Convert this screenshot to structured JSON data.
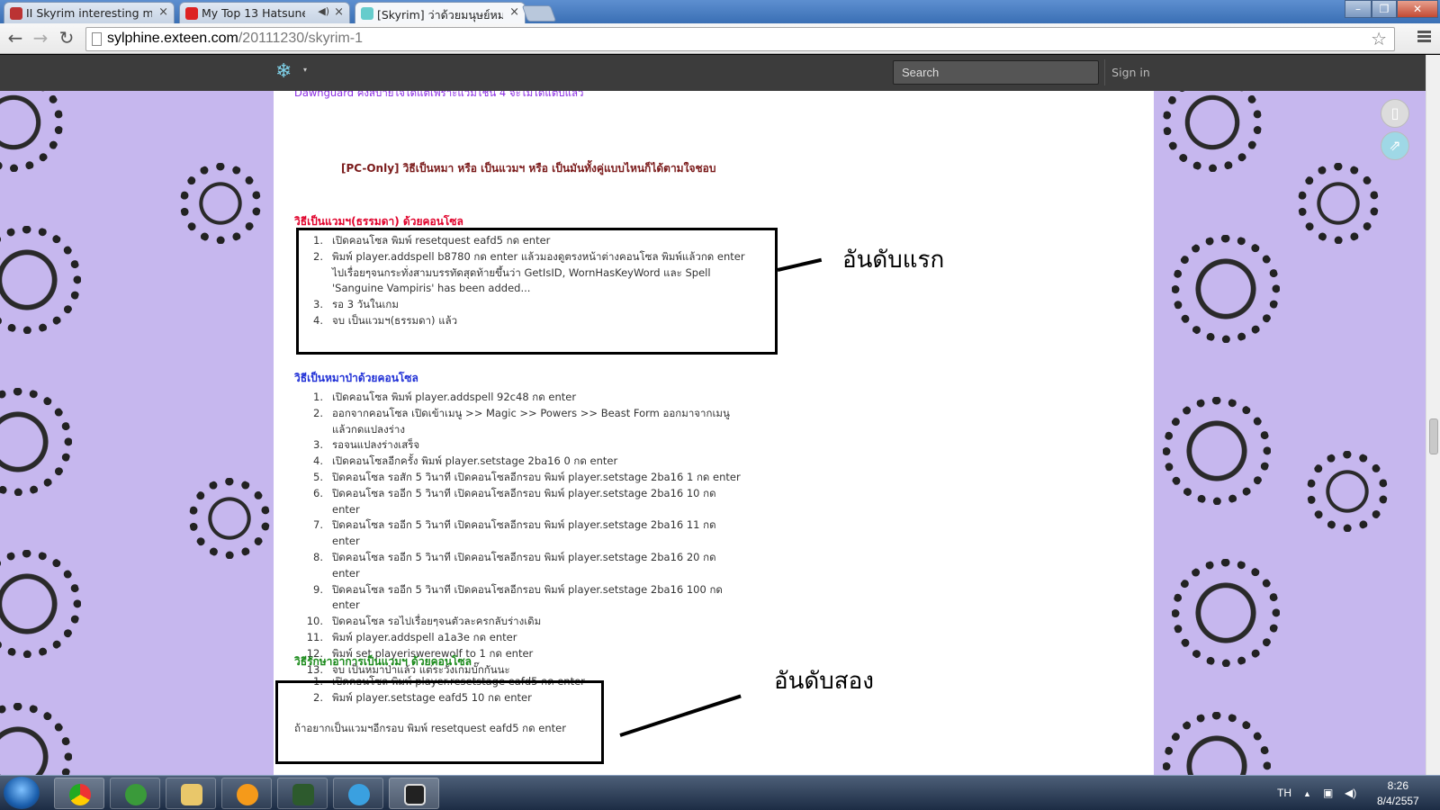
{
  "browser": {
    "tabs": [
      {
        "title": "II Skyrim interesting mo",
        "close": "×"
      },
      {
        "title": "My Top 13 Hatsune",
        "close": "×",
        "audio": "◀)"
      },
      {
        "title": "[Skyrim] ว่าด้วยมนุษย์หมาป",
        "close": "×"
      }
    ],
    "window_controls": {
      "minimize": "–",
      "maximize": "❐",
      "close": "✕"
    },
    "url_host": "sylphine.exteen.com",
    "url_path": "/20111230/skyrim-1",
    "back": "←",
    "forward": "→",
    "reload": "↻",
    "star": "☆"
  },
  "site": {
    "logo": "❄",
    "caret": "▾",
    "search_placeholder": "Search",
    "signin": "Sign in"
  },
  "article": {
    "intro": "Dawnguard คงสบายใจได้แต่เพราะแวมไชน์ 4 จะไม่ได้แต่บแล้ว",
    "subtitle": "[PC-Only] วิธีเป็นหมา หรือ เป็นแวมฯ หรือ เป็นมันทั้งคู่แบบไหนก็ได้ตามใจชอบ",
    "section1": {
      "heading": "วิธีเป็นแวมฯ(ธรรมดา) ด้วยคอนโซล",
      "items": [
        {
          "n": "1.",
          "t": "เปิดคอนโซล พิมพ์ resetquest eafd5 กด enter"
        },
        {
          "n": "2.",
          "t": "พิมพ์ player.addspell b8780 กด enter แล้วมองดูตรงหน้าต่างคอนโซล พิมพ์แล้วกด enter ไปเรื่อยๆจนกระทั่งสามบรรทัดสุดท้ายขึ้นว่า GetIsID, WornHasKeyWord และ Spell 'Sanguine Vampiris' has been added..."
        },
        {
          "n": "3.",
          "t": "รอ 3 วันในเกม"
        },
        {
          "n": "4.",
          "t": "จบ เป็นแวมฯ(ธรรมดา) แล้ว"
        }
      ]
    },
    "section2": {
      "heading": "วิธีเป็นหมาป่าด้วยคอนโซล",
      "items": [
        {
          "n": "1.",
          "t": "เปิดคอนโซล พิมพ์ player.addspell 92c48 กด enter"
        },
        {
          "n": "2.",
          "t": "ออกจากคอนโซล เปิดเข้าเมนู >> Magic >> Powers >> Beast Form ออกมาจากเมนูแล้วกดแปลงร่าง"
        },
        {
          "n": "3.",
          "t": "รอจนแปลงร่างเสร็จ"
        },
        {
          "n": "4.",
          "t": "เปิดคอนโซลอีกครั้ง พิมพ์ player.setstage 2ba16 0 กด enter"
        },
        {
          "n": "5.",
          "t": "ปิดคอนโซล รอสัก 5 วินาที เปิดคอนโซลอีกรอบ พิมพ์ player.setstage 2ba16 1 กด enter"
        },
        {
          "n": "6.",
          "t": "ปิดคอนโซล รออีก 5 วินาที เปิดคอนโซลอีกรอบ พิมพ์ player.setstage 2ba16 10 กด enter"
        },
        {
          "n": "7.",
          "t": "ปิดคอนโซล รออีก 5 วินาที เปิดคอนโซลอีกรอบ พิมพ์ player.setstage 2ba16 11 กด enter"
        },
        {
          "n": "8.",
          "t": "ปิดคอนโซล รออีก 5 วินาที เปิดคอนโซลอีกรอบ พิมพ์ player.setstage 2ba16 20 กด enter"
        },
        {
          "n": "9.",
          "t": "ปิดคอนโซล รออีก 5 วินาที เปิดคอนโซลอีกรอบ พิมพ์ player.setstage 2ba16 100 กด enter"
        },
        {
          "n": "10.",
          "t": "ปิดคอนโซล รอไปเรื่อยๆจนตัวละครกลับร่างเดิม"
        },
        {
          "n": "11.",
          "t": "พิมพ์ player.addspell a1a3e กด enter"
        },
        {
          "n": "12.",
          "t": "พิมพ์ set playeriswerewolf to 1 กด enter"
        },
        {
          "n": "13.",
          "t": "จบ เป็นหมาป่าแล้ว แต่ระวังเกมบั๊กกันนะ"
        }
      ]
    },
    "section3": {
      "heading": "วิธีรักษาอาการเป็นแวมฯ ด้วยคอนโซล",
      "items": [
        {
          "n": "1.",
          "t": "เปิดคอนโซล พิมพ์ player.resetstage eafd5 กด enter"
        },
        {
          "n": "2.",
          "t": "พิมพ์ player.setstage eafd5 10 กด enter"
        }
      ],
      "note": "ถ้าอยากเป็นแวมฯอีกรอบ พิมพ์ resetquest eafd5 กด enter"
    },
    "annotation1": "อันดับแรก",
    "annotation2": "อันดับสอง"
  },
  "taskbar": {
    "lang": "TH",
    "time": "8:26",
    "date": "8/4/2557"
  },
  "colors": {
    "heading1": "#e0002a",
    "heading2": "#1f2fd6",
    "heading3": "#1a8a1a"
  }
}
